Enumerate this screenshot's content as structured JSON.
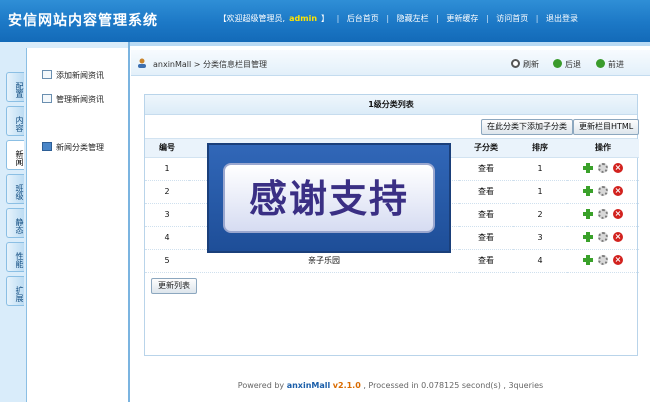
{
  "header": {
    "title": "安信网站内容管理系统",
    "welcome_prefix": "【欢迎超级管理员,",
    "admin_name": "admin",
    "welcome_suffix": "】",
    "links": [
      "后台首页",
      "隐藏左栏",
      "更新缓存",
      "访问首页",
      "退出登录"
    ]
  },
  "sidebar": {
    "tabs": [
      "配置",
      "内容",
      "新闻",
      "班级",
      "静态",
      "性能",
      "扩展"
    ],
    "active_tab": "新闻",
    "menu": [
      "添加新闻资讯",
      "管理新闻资讯",
      "新闻分类管理"
    ]
  },
  "breadcrumb": {
    "site": "anxinMall",
    "sep": ">",
    "page": "分类信息栏目管理"
  },
  "nav_buttons": [
    "刷新",
    "后退",
    "前进"
  ],
  "panel": {
    "title": "1级分类列表",
    "toolbar_buttons": [
      "在此分类下添加子分类",
      "更新栏目HTML"
    ],
    "columns": [
      "编号",
      "子分类",
      "排序",
      "操作"
    ],
    "rows": [
      {
        "id": "1",
        "name": "",
        "sub": "查看",
        "order": "1"
      },
      {
        "id": "2",
        "name": "",
        "sub": "查看",
        "order": "1"
      },
      {
        "id": "3",
        "name": "",
        "sub": "查看",
        "order": "2"
      },
      {
        "id": "4",
        "name": "",
        "sub": "查看",
        "order": "3"
      },
      {
        "id": "5",
        "name": "亲子乐园",
        "sub": "查看",
        "order": "4"
      }
    ],
    "update_button": "更新列表"
  },
  "overlay": {
    "text": "感谢支持"
  },
  "footer": {
    "prefix": "Powered by",
    "brand": "anxinMall",
    "version": "v2.1.0",
    "suffix": ", Processed in 0.078125 second(s) , 3queries"
  }
}
